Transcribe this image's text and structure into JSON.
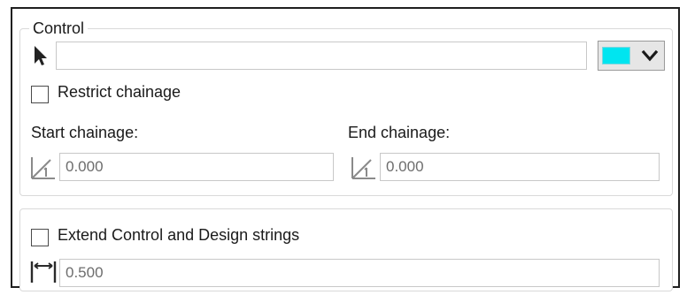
{
  "control": {
    "title": "Control",
    "pick_icon": "arrow-pointer-icon",
    "selector_value": "",
    "color": "#00e5f0",
    "restrict_label": "Restrict chainage",
    "start_label": "Start chainage:",
    "end_label": "End chainage:",
    "start_value": "0.000",
    "end_value": "0.000",
    "chainage_icon": "chainage-angle-icon"
  },
  "extend": {
    "label": "Extend Control and Design strings",
    "distance_icon": "distance-icon",
    "value": "0.500"
  }
}
